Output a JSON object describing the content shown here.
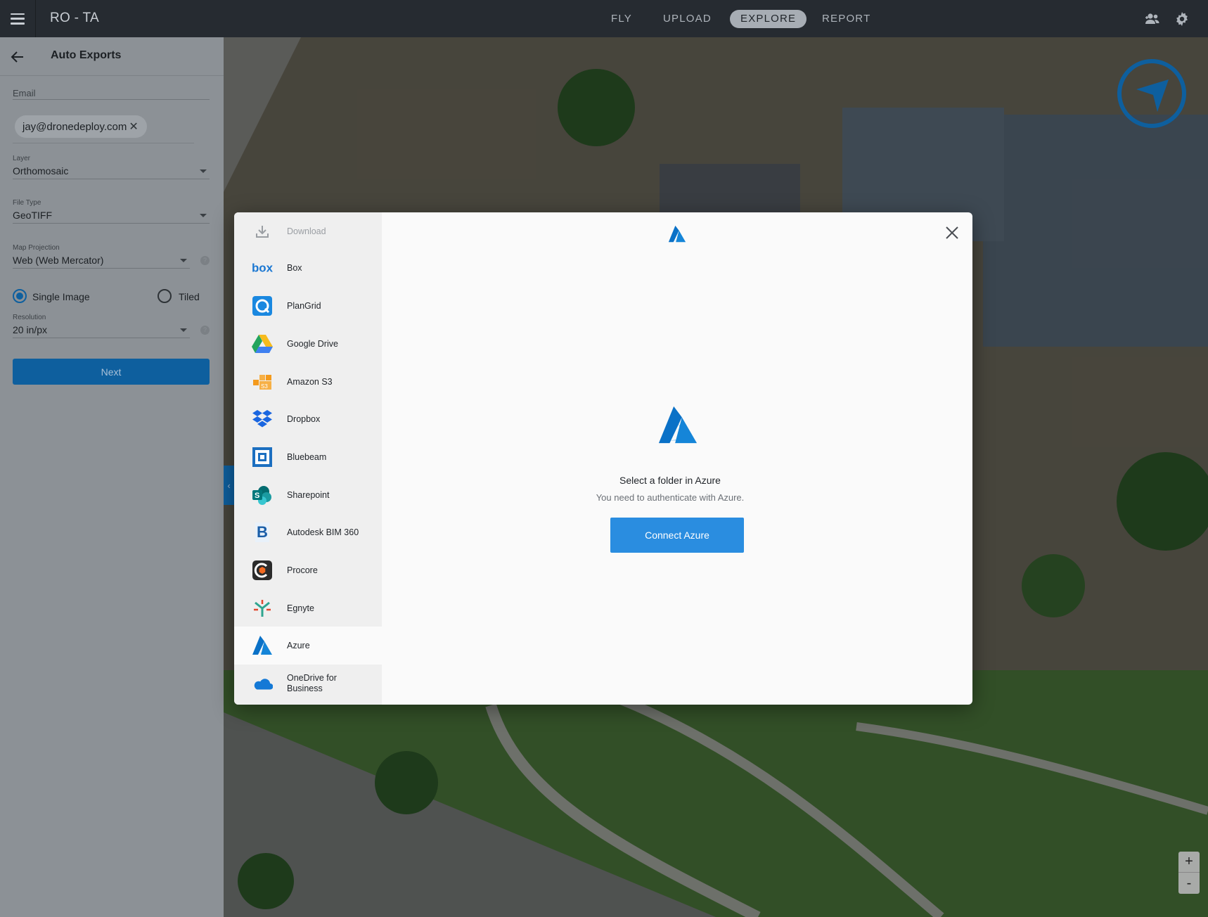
{
  "app": {
    "title": "RO - TA"
  },
  "nav": {
    "items": [
      "FLY",
      "UPLOAD",
      "EXPLORE",
      "REPORT"
    ],
    "active": "EXPLORE"
  },
  "panel": {
    "title": "Auto Exports",
    "email_label": "Email",
    "email_chip": "jay@dronedeploy.com",
    "layer_label": "Layer",
    "layer_value": "Orthomosaic",
    "filetype_label": "File Type",
    "filetype_value": "GeoTIFF",
    "projection_label": "Map Projection",
    "projection_value": "Web (Web Mercator)",
    "radio_single": "Single Image",
    "radio_tiled": "Tiled",
    "radio_selected": "Single Image",
    "resolution_label": "Resolution",
    "resolution_value": "20 in/px",
    "next_label": "Next"
  },
  "modal": {
    "providers": [
      "Download",
      "Box",
      "PlanGrid",
      "Google Drive",
      "Amazon S3",
      "Dropbox",
      "Bluebeam",
      "Sharepoint",
      "Autodesk BIM 360",
      "Procore",
      "Egnyte",
      "Azure",
      "OneDrive for Business"
    ],
    "selected_provider": "Azure",
    "title": "Select a folder in Azure",
    "subtitle": "You need to authenticate with Azure.",
    "connect_label": "Connect Azure"
  },
  "map": {
    "zoom_in": "+",
    "zoom_out": "-"
  },
  "colors": {
    "accent": "#2a8de0",
    "panel_button": "#0e5f9e",
    "topbar": "#262b31"
  }
}
